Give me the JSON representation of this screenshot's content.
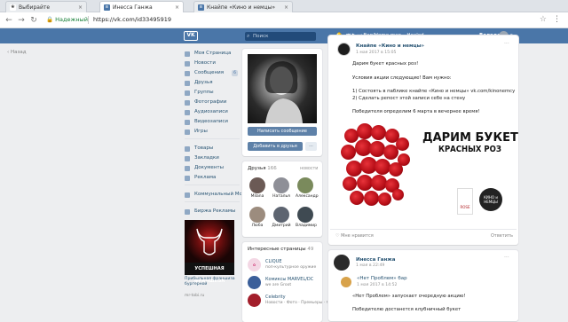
{
  "browser": {
    "tabs": [
      {
        "label": "Выбирайте",
        "icon": "paw-icon"
      },
      {
        "label": "Инесса Ганжа",
        "icon": "vk-icon"
      },
      {
        "label": "Кнайпе «Кино и немцы»",
        "icon": "vk-icon"
      }
    ],
    "secure_label": "Надежный",
    "url": "https://vk.com/id33495919"
  },
  "vk_header": {
    "logo": "VK",
    "search_placeholder": "Поиск",
    "player_text": "Bag/Home man – Healed",
    "user_name": "Володя"
  },
  "back_label": "Назад",
  "sidebar": {
    "items": [
      {
        "label": "Моя Страница",
        "icon": "home-icon"
      },
      {
        "label": "Новости",
        "icon": "news-icon"
      },
      {
        "label": "Сообщения",
        "icon": "message-icon",
        "badge": "6"
      },
      {
        "label": "Друзья",
        "icon": "friends-icon"
      },
      {
        "label": "Группы",
        "icon": "groups-icon"
      },
      {
        "label": "Фотографии",
        "icon": "photo-icon"
      },
      {
        "label": "Аудиозаписи",
        "icon": "audio-icon"
      },
      {
        "label": "Видеозаписи",
        "icon": "video-icon"
      },
      {
        "label": "Игры",
        "icon": "games-icon"
      }
    ],
    "items2": [
      {
        "label": "Товары",
        "icon": "goods-icon"
      },
      {
        "label": "Закладки",
        "icon": "bookmark-icon"
      },
      {
        "label": "Документы",
        "icon": "document-icon"
      },
      {
        "label": "Реклама",
        "icon": "ads-icon"
      }
    ],
    "items3": [
      {
        "label": "Коммунальный Мо...",
        "icon": "community-icon"
      }
    ],
    "items4": [
      {
        "label": "Биржа Рекламы",
        "icon": "ads-exchange-icon"
      }
    ]
  },
  "ad": {
    "banner_text": "УСПЕШНАЯ ФРАНШИЗА",
    "title": "Прибыльная франшиза бургерной",
    "site": "mr-tobi.ru"
  },
  "profile": {
    "message_button": "Написать сообщение",
    "add_friend_button": "Добавить в друзья",
    "more_button": "···"
  },
  "friends": {
    "title": "Друзья",
    "count": "166",
    "updates": "новости",
    "list": [
      {
        "name": "Milana"
      },
      {
        "name": "Наталья"
      },
      {
        "name": "Александр"
      },
      {
        "name": "Люба"
      },
      {
        "name": "Дмитрий"
      },
      {
        "name": "Владимир"
      }
    ]
  },
  "interesting": {
    "title": "Интересные страницы",
    "count": "49",
    "pages": [
      {
        "name": "CLIQUE",
        "desc": "поп-культурное оружие",
        "color": "#f3d7e4"
      },
      {
        "name": "Комиксы MARVEL/DC",
        "desc": "we are Groot",
        "color": "#3b5f9a"
      },
      {
        "name": "Celebrity",
        "desc": "Новости · Фото · Премьеры · Факты",
        "color": "#a21e2b"
      }
    ]
  },
  "post1": {
    "author": "Кнайпе «Кино и немцы»",
    "date": "1 мая 2017 в 15:05",
    "lines": [
      "Дарим букет красных роз!",
      "",
      "Условия акции следующие! Вам нужно:",
      "",
      "1) Состоять в паблике кнайпе «Кино и немцы» vk.com/kinonemcy",
      "2) Сделать репост этой записи себе на стену",
      "",
      "Победителя определим 6 марта в вечернее время!"
    ],
    "image_title": "ДАРИМ БУКЕТ",
    "image_subtitle": "КРАСНЫХ РОЗ",
    "logo1": "ROSE",
    "logo2": "КИНО и НЕМЦЫ",
    "like": "Мне нравится",
    "reply": "Ответить"
  },
  "post2": {
    "author": "Инесса Ганжа",
    "date": "1 мая в 22:49",
    "repost_author": "«Нет Проблем» бар",
    "repost_date": "1 мая 2017 в 14:52",
    "line1": "«Нет Проблем» запускает очередную акцию!",
    "line2": "Победителю достанется клубничный букет"
  }
}
